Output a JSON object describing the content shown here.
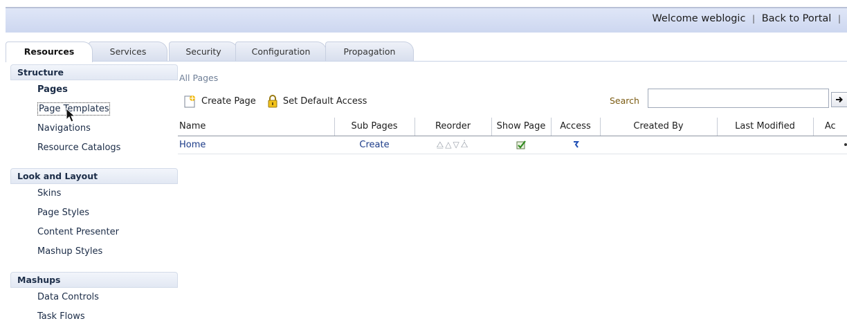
{
  "header": {
    "welcome_text": "Welcome weblogic",
    "separator": "|",
    "back_to_portal": "Back to Portal"
  },
  "tabs": [
    {
      "label": "Resources",
      "active": true
    },
    {
      "label": "Services",
      "active": false
    },
    {
      "label": "Security",
      "active": false
    },
    {
      "label": "Configuration",
      "active": false
    },
    {
      "label": "Propagation",
      "active": false
    }
  ],
  "sidebar": {
    "sections": [
      {
        "title": "Structure",
        "items": [
          "Pages",
          "Page Templates",
          "Navigations",
          "Resource Catalogs"
        ]
      },
      {
        "title": "Look and Layout",
        "items": [
          "Skins",
          "Page Styles",
          "Content Presenter",
          "Mashup Styles"
        ]
      },
      {
        "title": "Mashups",
        "items": [
          "Data Controls",
          "Task Flows"
        ]
      }
    ],
    "selected_item": "Pages",
    "focused_item": "Page Templates"
  },
  "main": {
    "breadcrumb": "All Pages",
    "toolbar": {
      "create_page": "Create Page",
      "set_default_access": "Set Default Access"
    },
    "search": {
      "label": "Search",
      "value": ""
    },
    "table": {
      "columns": [
        "Name",
        "Sub Pages",
        "Reorder",
        "Show Page",
        "Access",
        "Created By",
        "Last Modified",
        "Ac"
      ],
      "rows": [
        {
          "name": "Home",
          "sub_pages": "Create",
          "reorder": [
            "⧋",
            "△",
            "▽",
            "⧊"
          ],
          "show_page": true,
          "access": "edit-access-icon",
          "created_by": "",
          "last_modified": ""
        }
      ]
    }
  },
  "colors": {
    "banner": "#d6def3",
    "link": "#1b3b88",
    "search_label": "#7a5a10"
  }
}
